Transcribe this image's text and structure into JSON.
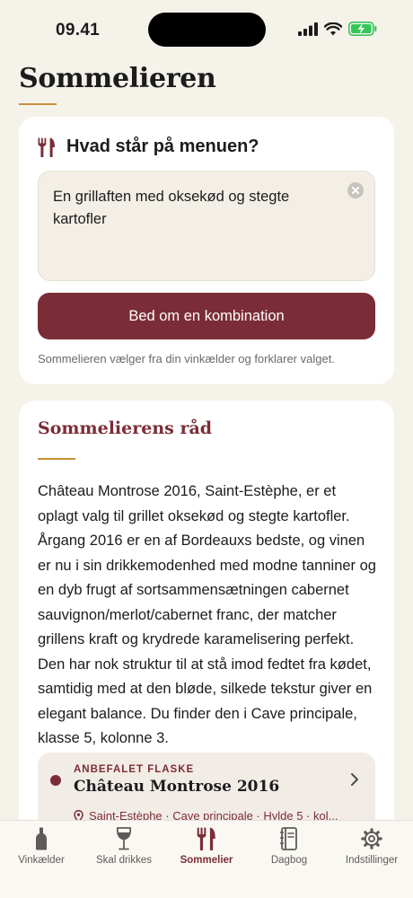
{
  "status_bar": {
    "time": "09.41"
  },
  "page": {
    "title": "Sommelieren"
  },
  "menu_card": {
    "title": "Hvad står på menuen?",
    "input_value": "En grillaften med oksekød og stegte kartofler",
    "button_label": "Bed om en kombination",
    "helper_text": "Sommelieren vælger fra din vinkælder og forklarer valget."
  },
  "advice_card": {
    "title": "Sommelierens råd",
    "body": "Château Montrose 2016, Saint-Estèphe, er et oplagt valg til grillet oksekød og stegte kartofler. Årgang 2016 er en af Bordeauxs bedste, og vinen er nu i sin drikkemodenhed med modne tanniner og en dyb frugt af sortsammensætningen cabernet sauvignon/merlot/cabernet franc, der matcher grillens kraft og krydrede karamelisering perfekt. Den har nok struktur til at stå imod fedtet fra kødet, samtidig med at den bløde, silkede tekstur giver en elegant balance. Du finder den i Cave principale, klasse 5, kolonne 3.",
    "recommendation": {
      "kicker": "ANBEFALET FLASKE",
      "name": "Château Montrose 2016",
      "location": "Saint-Estèphe · Cave principale · Hylde 5 · kol..."
    }
  },
  "tab_bar": {
    "items": [
      {
        "label": "Vinkælder",
        "icon": "wine-bottle-icon"
      },
      {
        "label": "Skal drikkes",
        "icon": "wine-glass-icon"
      },
      {
        "label": "Sommelier",
        "icon": "fork-knife-icon",
        "active": true
      },
      {
        "label": "Dagbog",
        "icon": "journal-icon"
      },
      {
        "label": "Indstillinger",
        "icon": "gear-icon"
      }
    ]
  },
  "colors": {
    "accent": "#7b2d37",
    "gold": "#c8923a",
    "background": "#f5f2ea",
    "card": "#ffffff",
    "battery": "#34c759"
  }
}
